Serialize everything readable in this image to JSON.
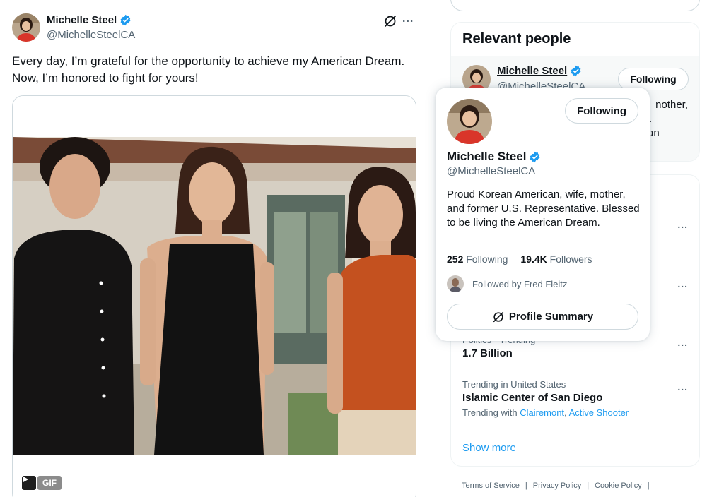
{
  "post": {
    "author_name": "Michelle Steel",
    "author_handle": "@MichelleSteelCA",
    "text": "Every day, I’m grateful for the opportunity to achieve my American Dream. Now, I’m honored to fight for yours!",
    "more_icon": "...",
    "media": {
      "gif_badge": "GIF"
    }
  },
  "relevant_people": {
    "title": "Relevant people",
    "name": "Michelle Steel",
    "handle": "@MichelleSteelCA",
    "follow_label": "Following",
    "bio_fragment_1": "nother,",
    "bio_fragment_2": ".",
    "bio_fragment_3": "an"
  },
  "hover_card": {
    "follow_label": "Following",
    "name": "Michelle Steel",
    "handle": "@MichelleSteelCA",
    "bio": "Proud Korean American, wife, mother, and former U.S. Representative. Blessed to be living the American Dream.",
    "following_count": "252",
    "following_label": "Following",
    "followers_count": "19.4K",
    "followers_label": "Followers",
    "followed_by": "Followed by Fred Fleitz",
    "summary_label": "Profile Summary"
  },
  "trends": {
    "item_a_meta": "Politics · Trending",
    "item_a_topic": "1.7 Billion",
    "item_b_meta": "Trending in United States",
    "item_b_topic": "Islamic Center of San Diego",
    "item_b_with_prefix": "Trending with",
    "item_b_with_link1": "Clairemont",
    "item_b_with_sep": ",",
    "item_b_with_link2": "Active Shooter",
    "more_icon": "...",
    "show_more": "Show more"
  },
  "footer": {
    "links": [
      "Terms of Service",
      "Privacy Policy",
      "Cookie Policy"
    ],
    "separator": "|"
  },
  "colors": {
    "accent": "#1d9bf0",
    "text_primary": "#0f1419",
    "text_secondary": "#536471",
    "border": "#cfd9de"
  },
  "icons": {
    "verified": "verified-badge-icon",
    "grok": "grok-icon",
    "more": "more-icon",
    "play": "play-icon"
  }
}
